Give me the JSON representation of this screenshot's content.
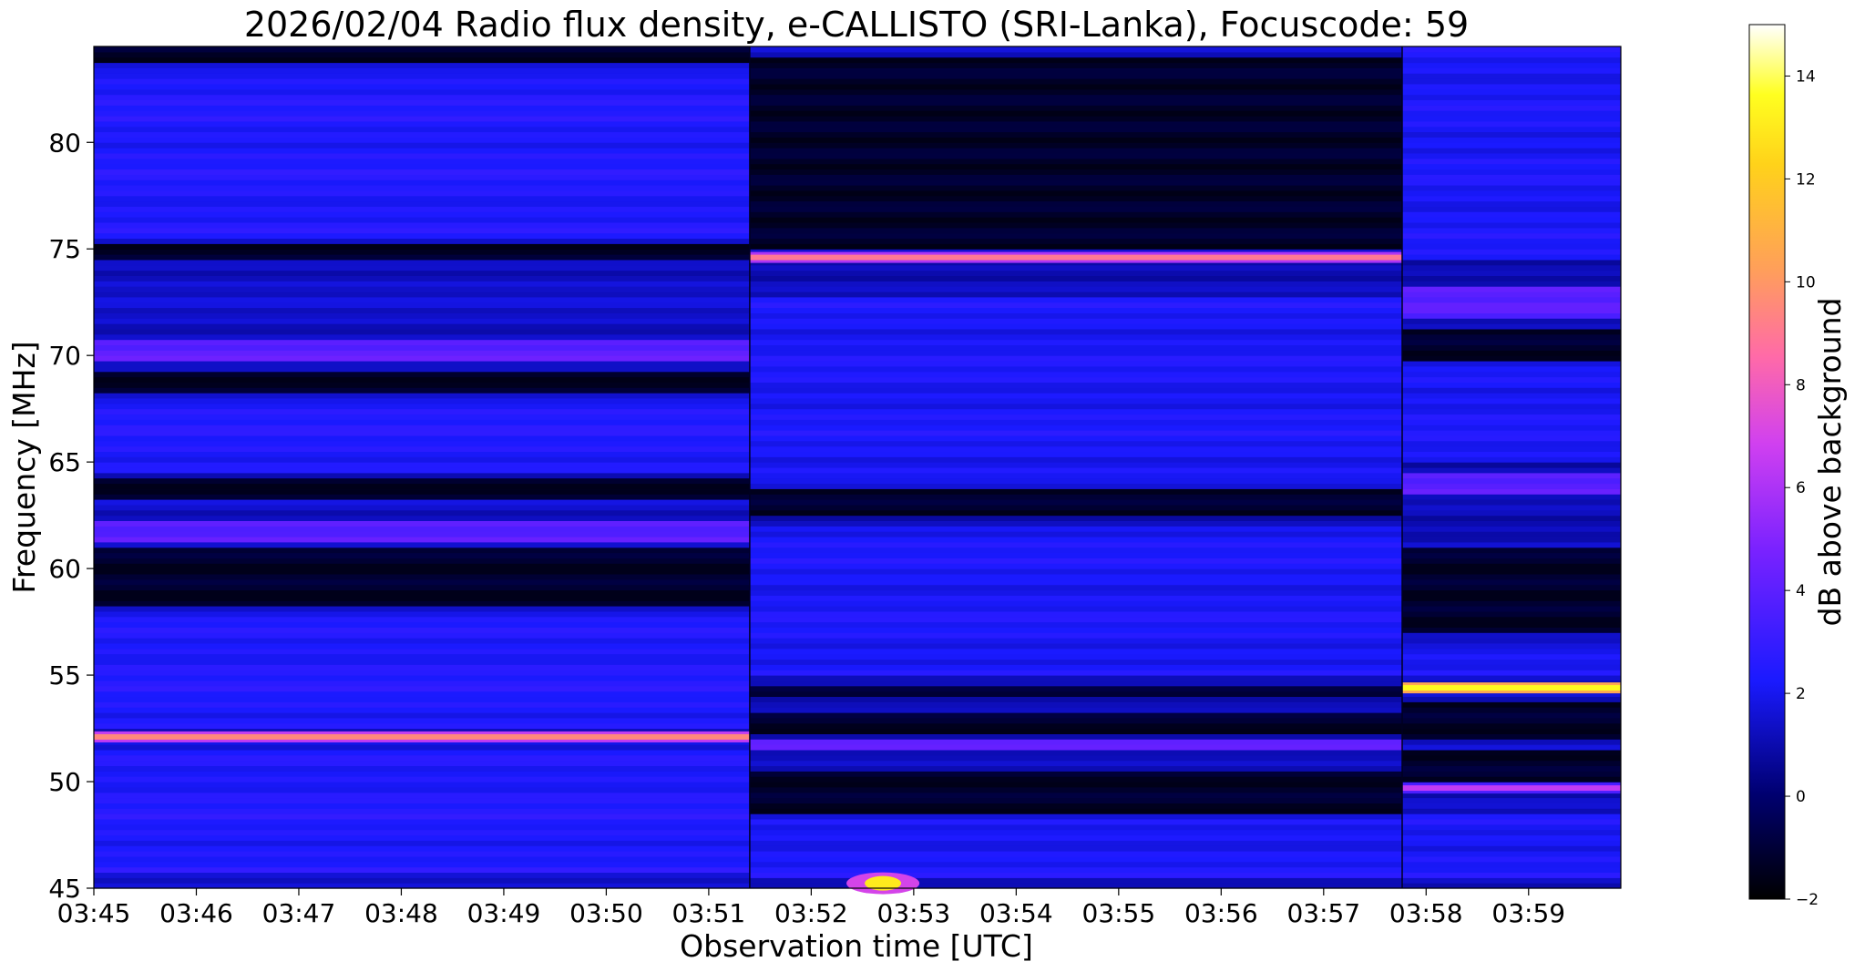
{
  "chart_data": {
    "type": "heatmap",
    "title": "2026/02/04  Radio flux density, e-CALLISTO (SRI-Lanka), Focuscode: 59",
    "xlabel": "Observation time [UTC]",
    "ylabel": "Frequency [MHz]",
    "x_range": [
      "03:45:00",
      "03:59:54"
    ],
    "y_range": [
      45,
      84.5
    ],
    "x_ticks": [
      "03:45",
      "03:46",
      "03:47",
      "03:48",
      "03:49",
      "03:50",
      "03:51",
      "03:52",
      "03:53",
      "03:54",
      "03:55",
      "03:56",
      "03:57",
      "03:58",
      "03:59"
    ],
    "y_ticks": [
      45,
      50,
      55,
      60,
      65,
      70,
      75,
      80
    ],
    "colormap": "gnuplot2",
    "colorbar": {
      "label": "dB above background",
      "range": [
        -2,
        15
      ],
      "ticks": [
        -2,
        0,
        2,
        4,
        6,
        8,
        10,
        12,
        14
      ]
    },
    "segments": [
      {
        "start": "03:45:00",
        "end": "03:51:24",
        "background_db": 1.4,
        "quiet_bands": [
          [
            58.2,
            61.0
          ],
          [
            63.3,
            64.3
          ],
          [
            68.2,
            69.2
          ],
          [
            74.5,
            75.2
          ],
          [
            83.7,
            84.5
          ]
        ],
        "active_bands": [
          [
            45.8,
            51.5
          ],
          [
            52.5,
            57.8
          ],
          [
            64.5,
            68.0
          ],
          [
            75.4,
            83.5
          ]
        ],
        "interference_bands": [
          [
            61.2,
            62.3
          ],
          [
            69.8,
            70.8
          ]
        ],
        "strong_lines": [
          {
            "freq": 52.1,
            "db": 9.5
          }
        ]
      },
      {
        "start": "03:51:24",
        "end": "03:57:46",
        "background_db": 1.2,
        "quiet_bands": [
          [
            48.5,
            50.5
          ],
          [
            52.3,
            53.2
          ],
          [
            53.9,
            54.6
          ],
          [
            62.4,
            63.8
          ],
          [
            75.0,
            84.0
          ]
        ],
        "active_bands": [
          [
            45.5,
            48.3
          ],
          [
            55.0,
            62.0
          ],
          [
            64.0,
            72.8
          ]
        ],
        "interference_bands": [
          [
            51.5,
            52.0
          ]
        ],
        "strong_lines": [
          {
            "freq": 74.6,
            "db": 9.0
          }
        ],
        "bursts": [
          {
            "time": "03:52:42",
            "freq": 45.4,
            "db": 13
          }
        ]
      },
      {
        "start": "03:57:46",
        "end": "03:59:54",
        "background_db": 1.2,
        "quiet_bands": [
          [
            50.0,
            51.5
          ],
          [
            52.0,
            53.8
          ],
          [
            57.0,
            61.0
          ],
          [
            69.8,
            71.2
          ]
        ],
        "active_bands": [
          [
            45.5,
            48.5
          ],
          [
            55.0,
            56.5
          ],
          [
            65.0,
            69.5
          ],
          [
            74.5,
            84.5
          ]
        ],
        "interference_bands": [
          [
            63.6,
            64.5
          ],
          [
            71.8,
            73.2
          ]
        ],
        "strong_lines": [
          {
            "freq": 54.4,
            "db": 13.5
          },
          {
            "freq": 49.7,
            "db": 6.5
          }
        ]
      }
    ]
  }
}
